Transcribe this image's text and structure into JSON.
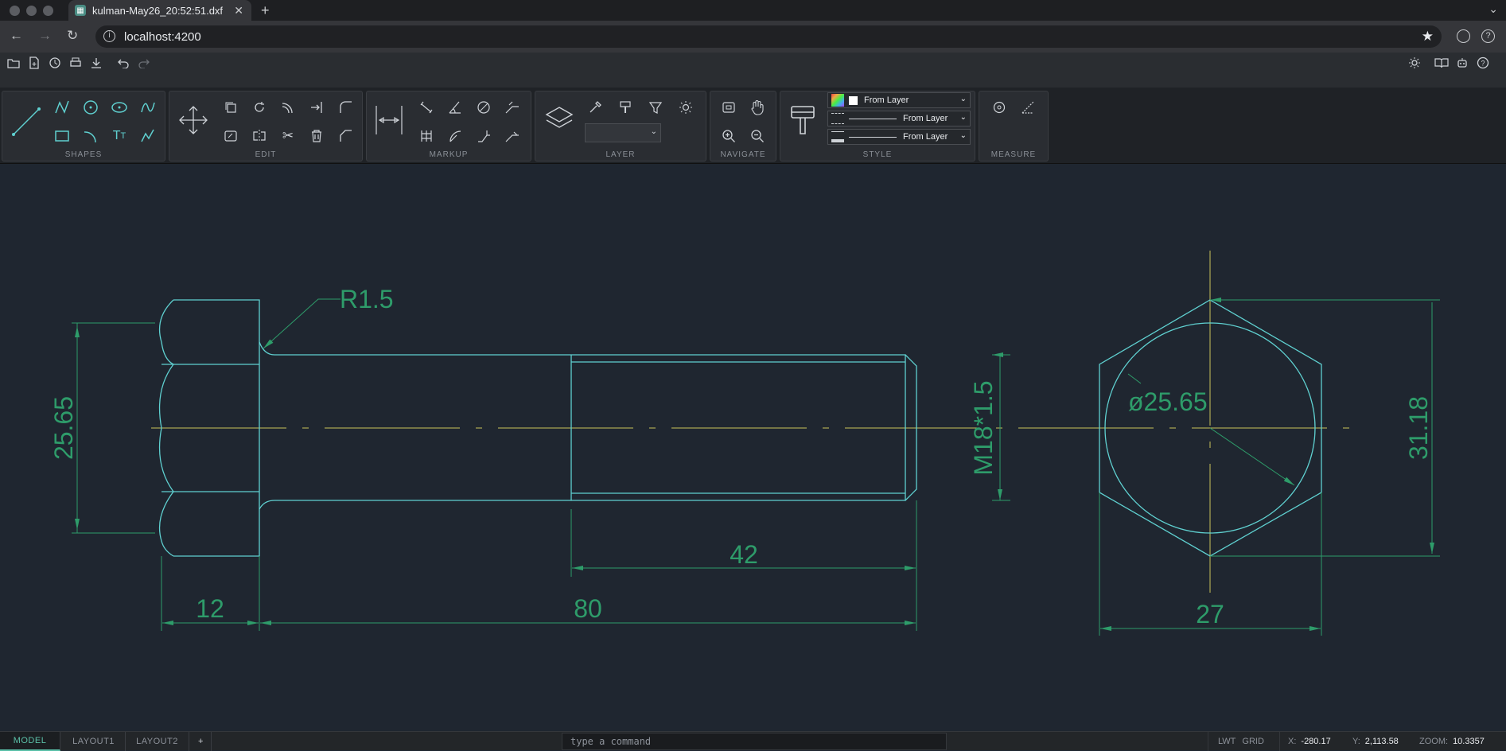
{
  "browser": {
    "tab_title": "kulman-May26_20:52:51.dxf",
    "url": "localhost:4200"
  },
  "ribbon": {
    "groups": [
      "SHAPES",
      "EDIT",
      "MARKUP",
      "LAYER",
      "NAVIGATE",
      "STYLE",
      "MEASURE"
    ],
    "style_color": "From Layer",
    "style_linetype": "From Layer",
    "style_lineweight": "From Layer"
  },
  "drawing": {
    "dim_r": "R1.5",
    "dim_head_height": "25.65",
    "dim_thread": "M18*1.5",
    "dim_diameter": "ø25.65",
    "dim_across_corners": "31.18",
    "dim_head_len": "12",
    "dim_shank_len": "80",
    "dim_thread_len": "42",
    "dim_across_flats": "27",
    "colors": {
      "geometry": "#5fd0d0",
      "dimension": "#2e9c6a",
      "centerline": "#c9c35a"
    }
  },
  "bottom": {
    "tabs": [
      "MODEL",
      "LAYOUT1",
      "LAYOUT2",
      "+"
    ],
    "command_placeholder": "type a command",
    "lwt": "LWT",
    "grid": "GRID",
    "x_label": "X:",
    "x_value": "-280.17",
    "y_label": "Y:",
    "y_value": "2,113.58",
    "zoom_label": "ZOOM:",
    "zoom_value": "10.3357"
  }
}
